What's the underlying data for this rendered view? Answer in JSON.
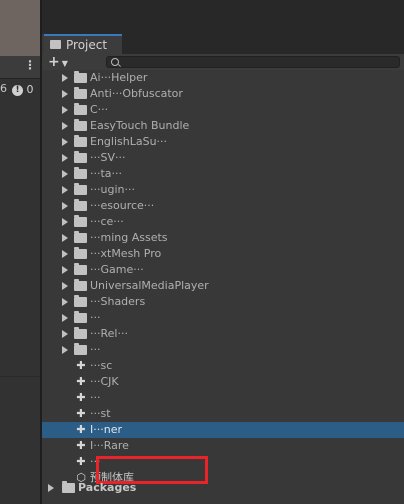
{
  "left_pane": {
    "menu_label": "⋮",
    "count_label": "6",
    "info_badge": "0"
  },
  "project_window": {
    "tab_title": "Project",
    "toolbar": {
      "create_label": "+",
      "search_placeholder": ""
    },
    "tree": [
      {
        "label": "Ai···Helper",
        "kind": "folder",
        "visible": "partial"
      },
      {
        "label": "Anti···Obfuscator",
        "kind": "folder",
        "visible": "partial"
      },
      {
        "label": "C···",
        "kind": "folder",
        "visible": "partial"
      },
      {
        "label": "EasyTouch Bundle",
        "kind": "folder",
        "visible": "partial"
      },
      {
        "label": "EnglishLaSu···",
        "kind": "folder",
        "visible": "partial"
      },
      {
        "label": "···SV···",
        "kind": "folder",
        "visible": "partial"
      },
      {
        "label": "···ta···",
        "kind": "folder",
        "visible": "partial"
      },
      {
        "label": "···ugin···",
        "kind": "folder",
        "visible": "partial"
      },
      {
        "label": "···esource···",
        "kind": "folder",
        "visible": "partial"
      },
      {
        "label": "···ce···",
        "kind": "folder",
        "visible": "partial"
      },
      {
        "label": "···ming Assets",
        "kind": "folder",
        "visible": "partial"
      },
      {
        "label": "···xtMesh Pro",
        "kind": "folder",
        "visible": "partial"
      },
      {
        "label": "···Game···",
        "kind": "folder",
        "visible": "partial"
      },
      {
        "label": "UniversalMediaPlayer",
        "kind": "folder",
        "visible": "partial"
      },
      {
        "label": "···Shaders",
        "kind": "folder",
        "visible": "partial"
      },
      {
        "label": "···",
        "kind": "folder",
        "visible": "partial"
      },
      {
        "label": "···Rel···",
        "kind": "folder",
        "visible": "partial"
      },
      {
        "label": "···",
        "kind": "folder",
        "visible": "partial"
      },
      {
        "label": "···sc",
        "kind": "asset",
        "visible": "partial"
      },
      {
        "label": "···CJK",
        "kind": "asset",
        "visible": "partial"
      },
      {
        "label": "···",
        "kind": "asset",
        "visible": "partial"
      },
      {
        "label": "···st",
        "kind": "asset",
        "visible": "partial"
      },
      {
        "label": "I···ner",
        "kind": "asset",
        "visible": "partial",
        "selected": true
      },
      {
        "label": "I···Rare",
        "kind": "asset",
        "visible": "partial"
      },
      {
        "label": "···",
        "kind": "asset",
        "visible": "partial"
      },
      {
        "label": "预制体库",
        "kind": "prefab",
        "visible": "full"
      }
    ],
    "packages_label": "Packages"
  },
  "colors": {
    "background": "#383838",
    "selection": "#2c5d87",
    "highlight_box": "#e8232a",
    "tab_accent": "#3a79bb"
  }
}
